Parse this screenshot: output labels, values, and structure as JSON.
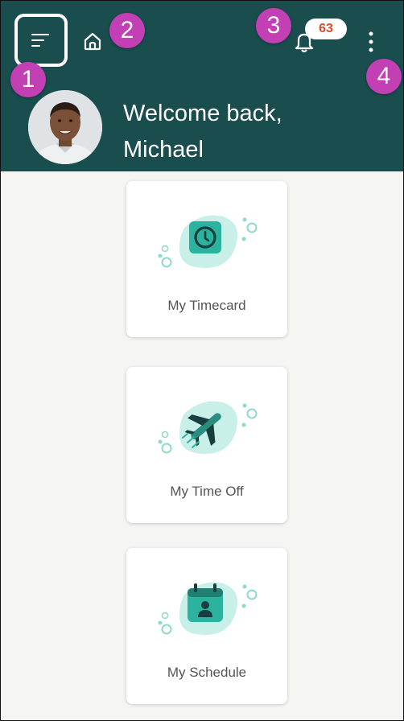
{
  "header": {
    "welcome_line1": "Welcome back,",
    "welcome_line2": "Michael",
    "notification_count": "63",
    "icons": [
      "menu-icon",
      "home-icon",
      "bell-icon",
      "more-vertical-icon"
    ]
  },
  "callouts": [
    "1",
    "2",
    "3",
    "4"
  ],
  "tiles": [
    {
      "label": "My Timecard",
      "icon": "clock-icon"
    },
    {
      "label": "My Time Off",
      "icon": "airplane-icon"
    },
    {
      "label": "My Schedule",
      "icon": "calendar-person-icon"
    }
  ],
  "colors": {
    "header_bg": "#1a4d4e",
    "accent": "#2bb3a0",
    "accent_light": "#c9efe9",
    "badge_text": "#d4502b",
    "callout": "#c23fb4",
    "page_bg": "#f5f5f4"
  }
}
